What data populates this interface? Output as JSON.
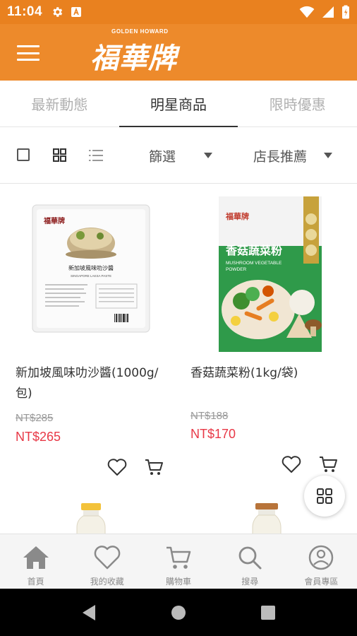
{
  "status_bar": {
    "time": "11:04",
    "icons": [
      "gear-icon",
      "a-icon",
      "wifi-icon",
      "battery-icon"
    ]
  },
  "header": {
    "logo_sub": "GOLDEN HOWARD",
    "logo_main": "福華牌",
    "menu_icon": "hamburger-icon"
  },
  "tabs": [
    {
      "label": "最新動態",
      "active": false
    },
    {
      "label": "明星商品",
      "active": true
    },
    {
      "label": "限時優惠",
      "active": false
    }
  ],
  "filter_bar": {
    "filter_label": "篩選",
    "sort_label": "店長推薦"
  },
  "products": [
    {
      "name": "新加坡風味叻沙醬(1000g/包)",
      "price_original": "NT$285",
      "price_sale": "NT$265",
      "package_text": {
        "brand": "福華牌",
        "title": "新加坡風味叻沙醬",
        "subtitle": "SINGAPORE LAKSA PASTE"
      }
    },
    {
      "name": "香菇蔬菜粉(1kg/袋)",
      "price_original": "NT$188",
      "price_sale": "NT$170",
      "package_text": {
        "brand": "福華牌",
        "title": "香菇蔬菜粉",
        "subtitle_line1": "MUSHROOM VEGETABLE",
        "subtitle_line2": "POWDER"
      }
    }
  ],
  "bottom_nav": [
    {
      "label": "首頁",
      "icon": "home-icon"
    },
    {
      "label": "我的收藏",
      "icon": "heart-icon"
    },
    {
      "label": "購物車",
      "icon": "cart-icon"
    },
    {
      "label": "搜尋",
      "icon": "search-icon"
    },
    {
      "label": "會員專區",
      "icon": "user-icon"
    }
  ],
  "colors": {
    "brand_orange": "#ed8a2b",
    "status_orange": "#e9811f",
    "sale_red": "#e83846",
    "package_green": "#2f9a4a"
  }
}
